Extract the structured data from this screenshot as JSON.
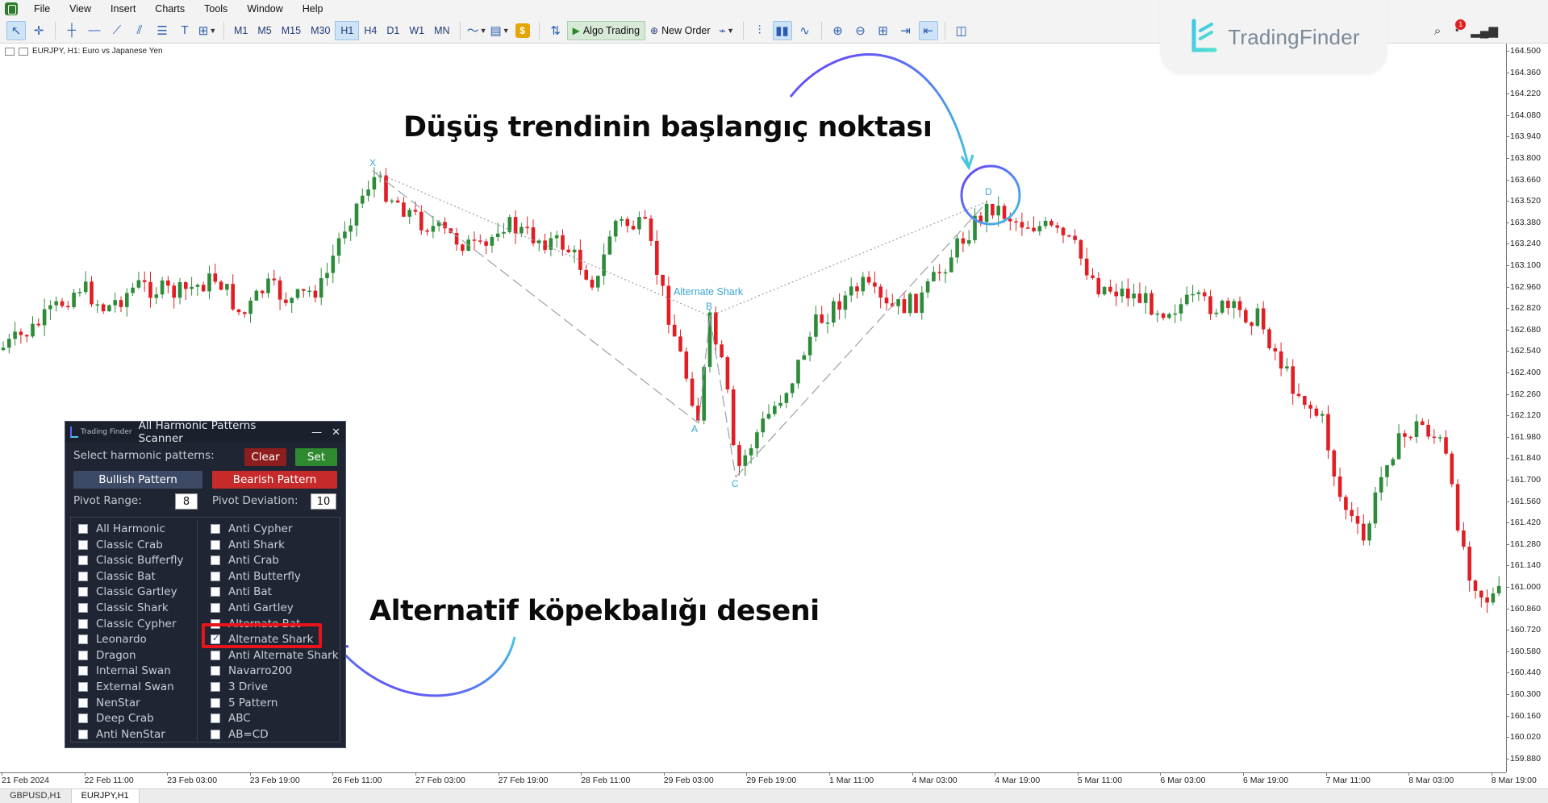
{
  "menu": [
    "File",
    "View",
    "Insert",
    "Charts",
    "Tools",
    "Window",
    "Help"
  ],
  "toolbar": {
    "timeframes": [
      "M1",
      "M5",
      "M15",
      "M30",
      "H1",
      "H4",
      "D1",
      "W1",
      "MN"
    ],
    "active_timeframe": "H1",
    "algo_trading_label": "Algo Trading",
    "new_order_label": "New Order",
    "dollar_glyph": "$",
    "notification_count": "1"
  },
  "logo": {
    "text": "TradingFinder"
  },
  "chart_info": {
    "symbol": "EURJPY, H1:  Euro vs Japanese Yen"
  },
  "price_axis": {
    "ticks": [
      "164.500",
      "164.360",
      "164.220",
      "164.080",
      "163.940",
      "163.800",
      "163.660",
      "163.520",
      "163.380",
      "163.240",
      "163.100",
      "162.960",
      "162.820",
      "162.680",
      "162.540",
      "162.400",
      "162.260",
      "162.120",
      "161.980",
      "161.840",
      "161.700",
      "161.560",
      "161.420",
      "161.280",
      "161.140",
      "161.000",
      "160.860",
      "160.720",
      "160.580",
      "160.440",
      "160.300",
      "160.160",
      "160.020",
      "159.880"
    ]
  },
  "time_axis": {
    "labels": [
      "21 Feb 2024",
      "22 Feb 11:00",
      "23 Feb 03:00",
      "23 Feb 19:00",
      "26 Feb 11:00",
      "27 Feb 03:00",
      "27 Feb 19:00",
      "28 Feb 11:00",
      "29 Feb 03:00",
      "29 Feb 19:00",
      "1 Mar 11:00",
      "4 Mar 03:00",
      "4 Mar 19:00",
      "5 Mar 11:00",
      "6 Mar 03:00",
      "6 Mar 19:00",
      "7 Mar 11:00",
      "8 Mar 03:00",
      "8 Mar 19:00"
    ]
  },
  "tabs": [
    "GBPUSD,H1",
    "EURJPY,H1"
  ],
  "active_tab": "EURJPY,H1",
  "annotations": {
    "top": "Düşüş trendinin başlangıç noktası",
    "bottom": "Alternatif köpekbalığı deseni"
  },
  "pattern": {
    "name": "Alternate Shark",
    "points": [
      "X",
      "A",
      "B",
      "C",
      "D"
    ]
  },
  "scanner": {
    "title": "All Harmonic Patterns Scanner",
    "brand": "Trading Finder",
    "minimize_glyph": "—",
    "close_glyph": "✕",
    "select_label": "Select harmonic patterns:",
    "clear_label": "Clear",
    "set_label": "Set",
    "bullish_label": "Bullish Pattern",
    "bearish_label": "Bearish Pattern",
    "pivot_range_label": "Pivot Range:",
    "pivot_range_value": "8",
    "pivot_deviation_label": "Pivot Deviation:",
    "pivot_deviation_value": "10",
    "left_patterns": [
      {
        "label": "All Harmonic",
        "checked": false
      },
      {
        "label": "Classic Crab",
        "checked": false
      },
      {
        "label": "Classic Bufferfly",
        "checked": false
      },
      {
        "label": "Classic Bat",
        "checked": false
      },
      {
        "label": "Classic Gartley",
        "checked": false
      },
      {
        "label": "Classic Shark",
        "checked": false
      },
      {
        "label": "Classic Cypher",
        "checked": false
      },
      {
        "label": "Leonardo",
        "checked": false
      },
      {
        "label": "Dragon",
        "checked": false
      },
      {
        "label": "Internal Swan",
        "checked": false
      },
      {
        "label": "External Swan",
        "checked": false
      },
      {
        "label": "NenStar",
        "checked": false
      },
      {
        "label": "Deep Crab",
        "checked": false
      },
      {
        "label": "Anti NenStar",
        "checked": false
      }
    ],
    "right_patterns": [
      {
        "label": "Anti Cypher",
        "checked": false
      },
      {
        "label": "Anti Shark",
        "checked": false
      },
      {
        "label": "Anti Crab",
        "checked": false
      },
      {
        "label": "Anti Butterfly",
        "checked": false
      },
      {
        "label": "Anti Bat",
        "checked": false
      },
      {
        "label": "Anti Gartley",
        "checked": false
      },
      {
        "label": "Alternate Bat",
        "checked": false
      },
      {
        "label": "Alternate Shark",
        "checked": true
      },
      {
        "label": "Anti Alternate Shark",
        "checked": false
      },
      {
        "label": "Navarro200",
        "checked": false
      },
      {
        "label": "3 Drive",
        "checked": false
      },
      {
        "label": "5 Pattern",
        "checked": false
      },
      {
        "label": "ABC",
        "checked": false
      },
      {
        "label": "AB=CD",
        "checked": false
      }
    ]
  },
  "colors": {
    "bull_candle": "#2e8b3a",
    "bear_candle": "#e01e24",
    "pattern_line": "#9aa0a6",
    "pattern_label": "#3aa6d6",
    "highlight_box": "#e8141a",
    "arrow_start": "#6a3cff",
    "arrow_end": "#45c6e0"
  }
}
